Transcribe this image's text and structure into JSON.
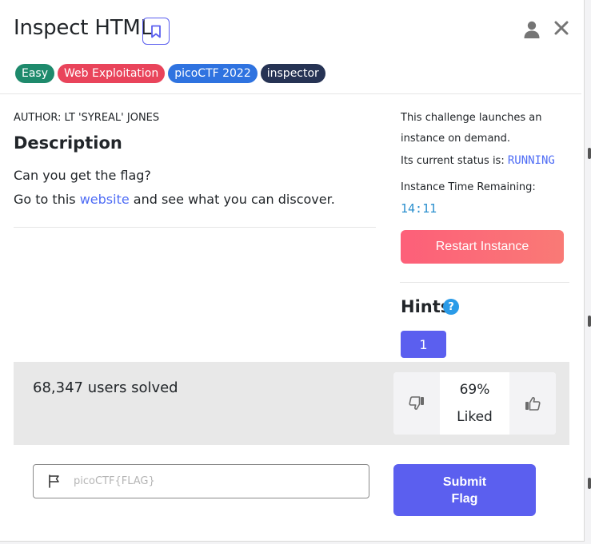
{
  "header": {
    "title": "Inspect HTML"
  },
  "tags": [
    {
      "label": "Easy",
      "color": "#1e8a6c"
    },
    {
      "label": "Web Exploitation",
      "color": "#e9445b"
    },
    {
      "label": "picoCTF 2022",
      "color": "#2f73e0"
    },
    {
      "label": "inspector",
      "color": "#263354"
    }
  ],
  "challenge": {
    "author": "AUTHOR: LT 'SYREAL' JONES",
    "description_heading": "Description",
    "line1": "Can you get the flag?",
    "line2_prefix": "Go to this ",
    "line2_link": "website",
    "line2_suffix": " and see what you can discover."
  },
  "instance": {
    "launch_text_1": "This challenge launches an",
    "launch_text_2": "instance on demand.",
    "status_label": "Its current status is: ",
    "status_value": "RUNNING",
    "time_label": "Instance Time Remaining:",
    "time_value": "14:11",
    "restart_label": "Restart Instance"
  },
  "hints": {
    "heading": "Hints",
    "help_glyph": "?",
    "buttons": [
      "1"
    ]
  },
  "stats": {
    "solved_text": "68,347 users solved",
    "liked_percent": "69%",
    "liked_label": "Liked"
  },
  "flag": {
    "placeholder": "picoCTF{FLAG}",
    "submit_line1": "Submit",
    "submit_line2": "Flag"
  },
  "icons": {
    "bookmark": "bookmark-icon",
    "user": "user-icon",
    "close": "close-icon",
    "help": "help-icon",
    "thumbs_down": "thumbs-down-icon",
    "thumbs_up": "thumbs-up-icon",
    "flag": "flag-icon"
  }
}
